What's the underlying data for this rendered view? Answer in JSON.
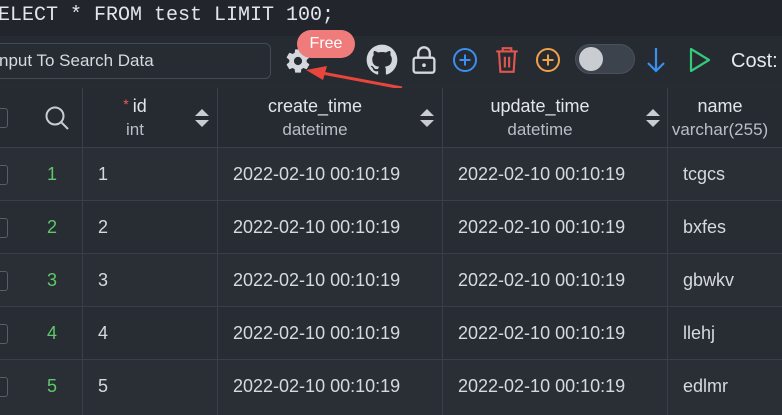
{
  "query": {
    "sql": "ELECT * FROM test LIMIT 100;"
  },
  "toolbar": {
    "search_placeholder": "nput To Search Data",
    "badge": "Free",
    "cost_label": "Cost:",
    "icons": [
      "gear-icon",
      "github-icon",
      "lock-icon",
      "add-circle-icon",
      "delete-icon",
      "add-circle-orange-icon",
      "toggle-switch",
      "download-arrow-icon",
      "run-icon"
    ],
    "accent_colors": {
      "badge": "#f07b7b",
      "blue": "#3b8ff0",
      "red": "#e0564f",
      "orange": "#f0a24a",
      "green": "#35c97a"
    }
  },
  "table": {
    "columns": [
      {
        "name": "id",
        "type": "int",
        "required": true
      },
      {
        "name": "create_time",
        "type": "datetime"
      },
      {
        "name": "update_time",
        "type": "datetime"
      },
      {
        "name": "name",
        "type": "varchar(255)"
      }
    ],
    "rows": [
      {
        "num": "1",
        "id": "1",
        "create_time": "2022-02-10 00:10:19",
        "update_time": "2022-02-10 00:10:19",
        "name": "tcgcs"
      },
      {
        "num": "2",
        "id": "2",
        "create_time": "2022-02-10 00:10:19",
        "update_time": "2022-02-10 00:10:19",
        "name": "bxfes"
      },
      {
        "num": "3",
        "id": "3",
        "create_time": "2022-02-10 00:10:19",
        "update_time": "2022-02-10 00:10:19",
        "name": "gbwkv"
      },
      {
        "num": "4",
        "id": "4",
        "create_time": "2022-02-10 00:10:19",
        "update_time": "2022-02-10 00:10:19",
        "name": "llehj"
      },
      {
        "num": "5",
        "id": "5",
        "create_time": "2022-02-10 00:10:19",
        "update_time": "2022-02-10 00:10:19",
        "name": "edlmr"
      }
    ]
  }
}
